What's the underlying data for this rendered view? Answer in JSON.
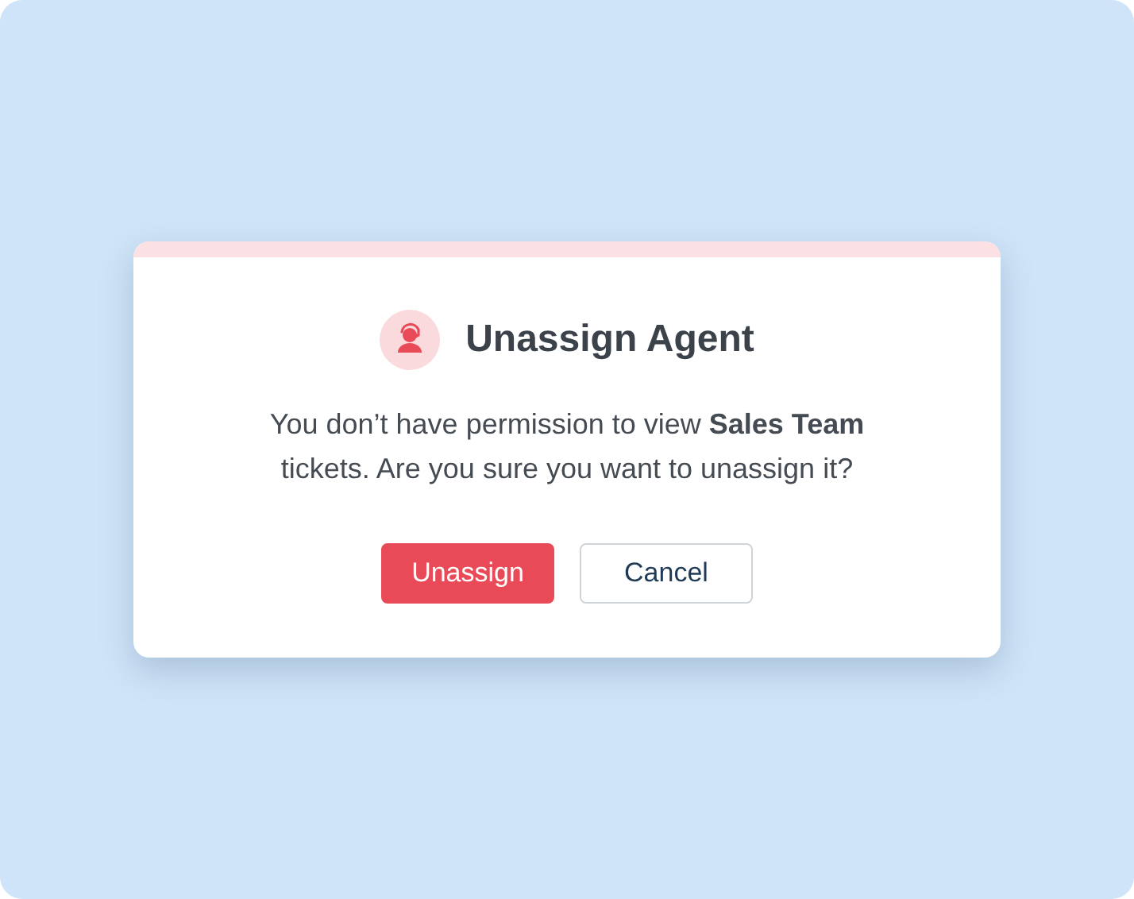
{
  "dialog": {
    "title": "Unassign Agent",
    "message": "You don’t have permission to view **Sales Team** tickets. Are you sure you want to unassign it?",
    "buttons": [
      {
        "label": "Unassign",
        "kind": "primary"
      },
      {
        "label": "Cancel",
        "kind": "secondary"
      }
    ]
  }
}
